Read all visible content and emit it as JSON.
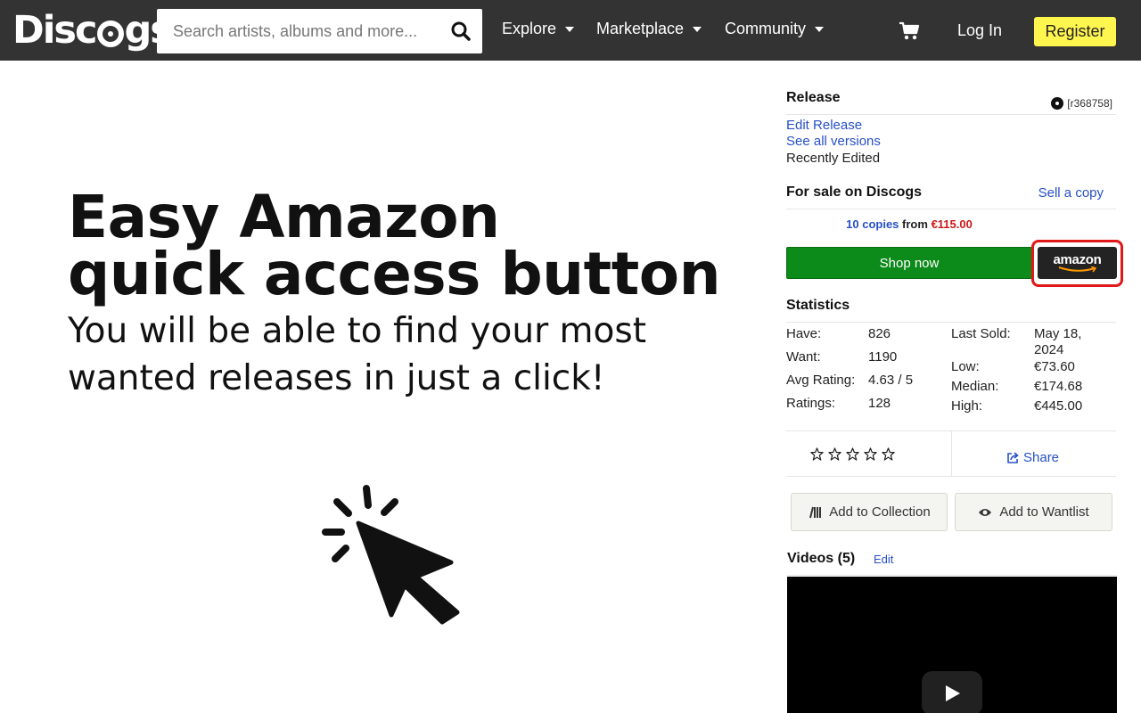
{
  "header": {
    "logo": "Discogs",
    "logo_before": "Disc",
    "logo_after": "gs",
    "search_placeholder": "Search artists, albums and more...",
    "nav": [
      "Explore",
      "Marketplace",
      "Community"
    ],
    "login_label": "Log In",
    "register_label": "Register"
  },
  "promo": {
    "title_lines": [
      "Easy Amazon",
      "quick access button"
    ],
    "subtitle_lines": [
      "You will be able to find your most",
      "wanted releases in just a click!"
    ]
  },
  "release": {
    "heading": "Release",
    "id": "[r368758]",
    "edit_label": "Edit Release",
    "versions_label": "See all versions",
    "status": "Recently Edited"
  },
  "sale": {
    "heading": "For sale on Discogs",
    "sell_label": "Sell a copy",
    "copies": "10 copies",
    "from_label": "from",
    "price": "€115.00",
    "shop_label": "Shop now",
    "amazon_label": "amazon"
  },
  "statistics": {
    "heading": "Statistics",
    "left": [
      {
        "label": "Have:",
        "value": "826"
      },
      {
        "label": "Want:",
        "value": "1190"
      },
      {
        "label": "Avg Rating:",
        "value": "4.63 / 5"
      },
      {
        "label": "Ratings:",
        "value": "128"
      }
    ],
    "last_sold_label": "Last Sold:",
    "last_sold_line1": "May 18,",
    "last_sold_line2": "2024",
    "right": [
      {
        "label": "Low:",
        "value": "€73.60"
      },
      {
        "label": "Median:",
        "value": "€174.68"
      },
      {
        "label": "High:",
        "value": "€445.00"
      }
    ]
  },
  "actions": {
    "share_label": "Share",
    "collection_label": "Add to Collection",
    "wantlist_label": "Add to Wantlist"
  },
  "videos": {
    "heading": "Videos (5)",
    "edit_label": "Edit"
  },
  "colors": {
    "header_bg": "#333333",
    "register_bg": "#fff54f",
    "link": "#2750c7",
    "price": "#d01818",
    "shop_green": "#0c8a1a",
    "highlight_red": "#e01818"
  }
}
